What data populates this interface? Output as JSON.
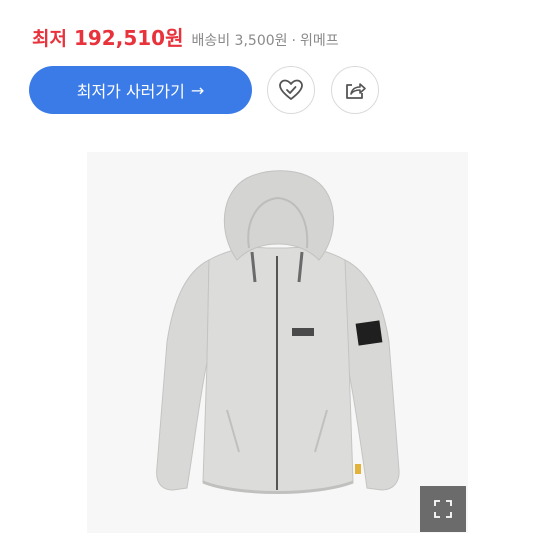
{
  "price": {
    "label": "최저",
    "value": "192,510원",
    "shipping": "배송비 3,500원",
    "separator": "·",
    "seller": "위메프",
    "accent_color": "#e8323c"
  },
  "actions": {
    "buy_label": "최저가 사러가기",
    "buy_arrow": "→",
    "buy_color": "#3a7be8",
    "like_icon": "heart-check-icon",
    "share_icon": "share-icon"
  },
  "product_image": {
    "subject": "jacket-photo",
    "expand_icon": "expand-icon"
  }
}
